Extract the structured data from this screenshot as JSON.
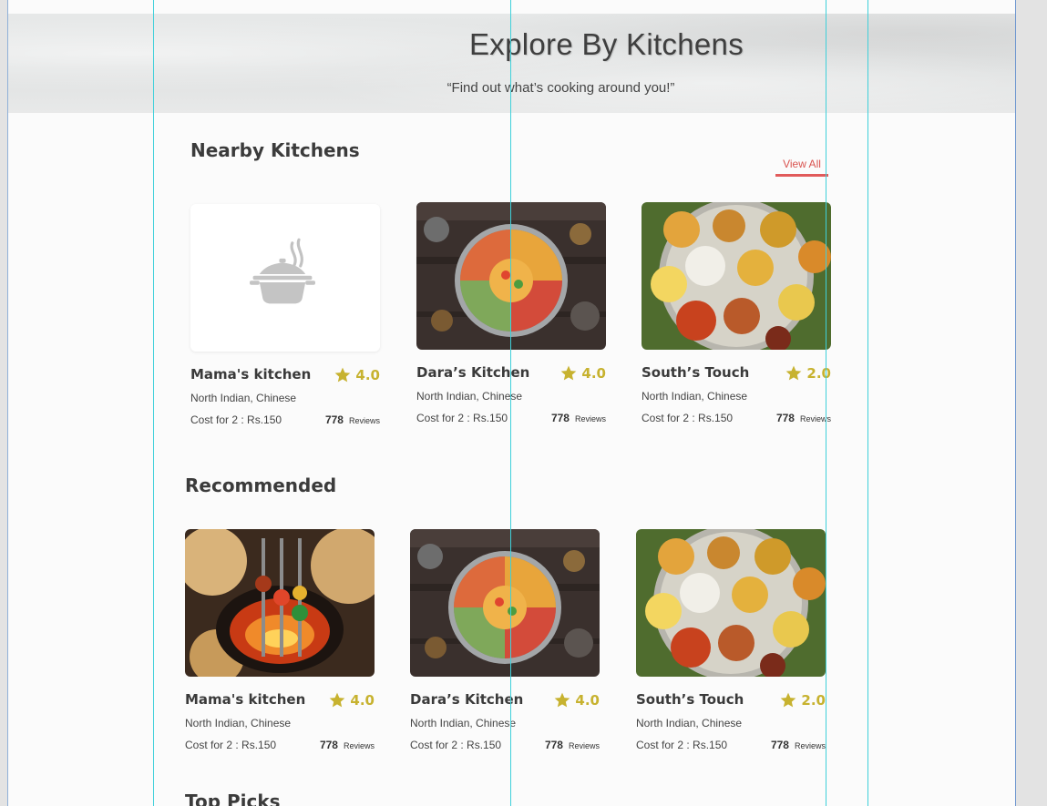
{
  "hero": {
    "title": "Explore By Kitchens",
    "subtitle": "“Find out what’s cooking around you!”"
  },
  "nearby": {
    "title": "Nearby Kitchens",
    "view_all": "View All",
    "cards": [
      {
        "name": "Mama's kitchen",
        "rating": "4.0",
        "cuisine": "North Indian, Chinese",
        "cost": "Cost for 2 : Rs.150",
        "reviews_count": "778",
        "reviews_label": "Reviews",
        "image": "cooking-pot-placeholder"
      },
      {
        "name": "Dara’s Kitchen",
        "rating": "4.0",
        "cuisine": "North Indian, Chinese",
        "cost": "Cost for 2 : Rs.150",
        "reviews_count": "778",
        "reviews_label": "Reviews",
        "image": "curry-platter-photo"
      },
      {
        "name": "South’s Touch",
        "rating": "2.0",
        "cuisine": "North Indian, Chinese",
        "cost": "Cost for 2 : Rs.150",
        "reviews_count": "778",
        "reviews_label": "Reviews",
        "image": "thali-photo"
      }
    ]
  },
  "recommended": {
    "title": "Recommended",
    "cards": [
      {
        "name": "Mama's kitchen",
        "rating": "4.0",
        "cuisine": "North Indian, Chinese",
        "cost": "Cost for 2 : Rs.150",
        "reviews_count": "778",
        "reviews_label": "Reviews",
        "image": "tandoor-photo"
      },
      {
        "name": "Dara’s Kitchen",
        "rating": "4.0",
        "cuisine": "North Indian, Chinese",
        "cost": "Cost for 2 : Rs.150",
        "reviews_count": "778",
        "reviews_label": "Reviews",
        "image": "curry-platter-photo"
      },
      {
        "name": "South’s Touch",
        "rating": "2.0",
        "cuisine": "North Indian, Chinese",
        "cost": "Cost for 2 : Rs.150",
        "reviews_count": "778",
        "reviews_label": "Reviews",
        "image": "thali-photo"
      }
    ]
  },
  "top_picks": {
    "title": "Top Picks"
  },
  "colors": {
    "accent_red": "#e15b5b",
    "rating_gold": "#c7b22f",
    "guide_cyan": "#3fd0da",
    "page_bg": "#fbfbfb"
  }
}
